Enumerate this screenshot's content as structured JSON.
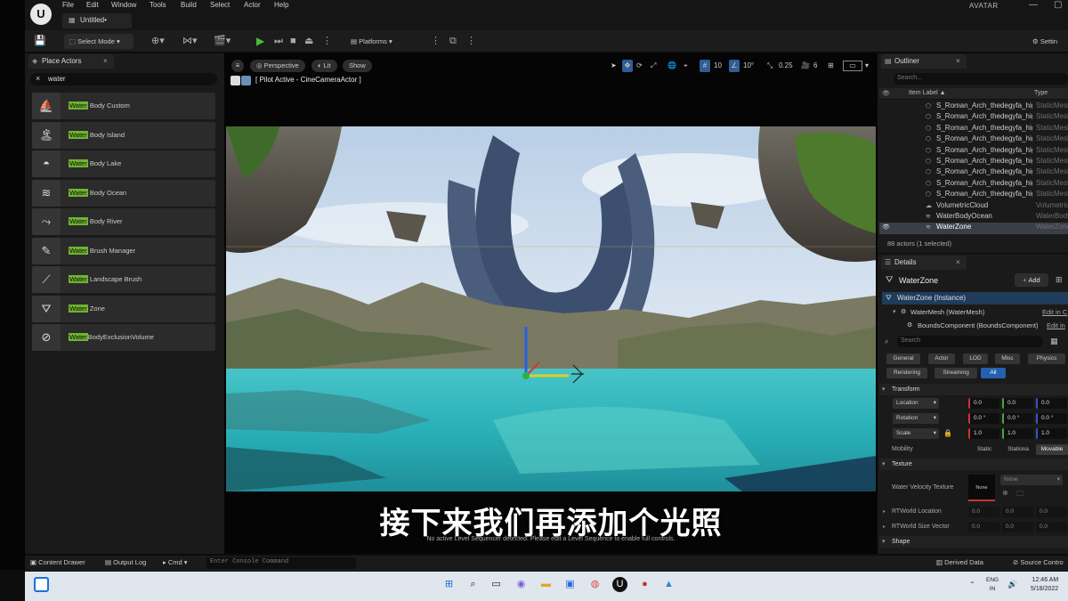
{
  "app": {
    "menu": [
      "File",
      "Edit",
      "Window",
      "Tools",
      "Build",
      "Select",
      "Actor",
      "Help"
    ],
    "document_tab": "Untitled•",
    "project_label": "AVATAR"
  },
  "toolbar": {
    "select_mode": "Select Mode",
    "platforms": "Platforms",
    "settings": "Settin"
  },
  "place_actors": {
    "tab_label": "Place Actors",
    "search_value": "water",
    "highlight": "Water",
    "items": [
      {
        "prefix": "Water",
        "rest": " Body Custom",
        "icon": "water-body-custom-icon"
      },
      {
        "prefix": "Water",
        "rest": " Body Island",
        "icon": "island-icon"
      },
      {
        "prefix": "Water",
        "rest": " Body Lake",
        "icon": "lake-icon"
      },
      {
        "prefix": "Water",
        "rest": " Body Ocean",
        "icon": "ocean-icon"
      },
      {
        "prefix": "Water",
        "rest": " Body River",
        "icon": "river-icon"
      },
      {
        "prefix": "Water",
        "rest": " Brush Manager",
        "icon": "brush-manager-icon"
      },
      {
        "prefix": "Water",
        "rest": " Landscape Brush",
        "icon": "landscape-brush-icon"
      },
      {
        "prefix": "Water",
        "rest": " Zone",
        "icon": "water-zone-icon"
      },
      {
        "prefix": "Water",
        "rest": "BodyExclusionVolume",
        "icon": "exclusion-volume-icon"
      }
    ]
  },
  "viewport": {
    "perspective": "Perspective",
    "lit": "Lit",
    "show": "Show",
    "grid_snap": "10",
    "rotation_snap": "10°",
    "scale_snap": "0.25",
    "camera_speed": "6",
    "pilot_label": "[ Pilot Active - CineCameraActor ]",
    "subtitle": "接下来我们再添加个光照",
    "sequencer_message": "No active Level Sequencer detected. Please edit a Level Sequence to enable full controls."
  },
  "outliner": {
    "tab_label": "Outliner",
    "search_placeholder": "Search...",
    "col_label": "Item Label ▲",
    "col_type": "Type",
    "rows": [
      {
        "name": "S_Roman_Arch_thedegyfa_hig",
        "type": "StaticMesh"
      },
      {
        "name": "S_Roman_Arch_thedegyfa_hig",
        "type": "StaticMesh"
      },
      {
        "name": "S_Roman_Arch_thedegyfa_hig",
        "type": "StaticMesh"
      },
      {
        "name": "S_Roman_Arch_thedegyfa_hig",
        "type": "StaticMesh"
      },
      {
        "name": "S_Roman_Arch_thedegyfa_hig",
        "type": "StaticMesh"
      },
      {
        "name": "S_Roman_Arch_thedegyfa_hig",
        "type": "StaticMesh"
      },
      {
        "name": "S_Roman_Arch_thedegyfa_hig",
        "type": "StaticMesh"
      },
      {
        "name": "S_Roman_Arch_thedegyfa_hig",
        "type": "StaticMesh"
      },
      {
        "name": "S_Roman_Arch_thedegyfa_hig",
        "type": "StaticMesh"
      },
      {
        "name": "VolumetricCloud",
        "type": "Volumetric"
      },
      {
        "name": "WaterBodyOcean",
        "type": "WaterBody"
      },
      {
        "name": "WaterZone",
        "type": "WaterZone"
      }
    ],
    "selected_index": 11,
    "count": "88 actors (1 selected)"
  },
  "details": {
    "tab_label": "Details",
    "title": "WaterZone",
    "add": "Add",
    "instance": "WaterZone (Instance)",
    "components": [
      {
        "label": "WaterMesh (WaterMesh)",
        "link": "Edit in C"
      },
      {
        "label": "BoundsComponent (BoundsComponent)",
        "link": "Edit in"
      }
    ],
    "search_placeholder": "Search",
    "categories": [
      "General",
      "Actor",
      "LOD",
      "Misc",
      "Physics",
      "Rendering",
      "Streaming",
      "All"
    ],
    "active_category": "All",
    "transform_header": "Transform",
    "location_label": "Location",
    "rotation_label": "Rotation",
    "scale_label": "Scale",
    "location": [
      "0.0",
      "0.0",
      "0.0"
    ],
    "rotation": [
      "0.0 °",
      "0.0 °",
      "0.0 °"
    ],
    "scale": [
      "1.0",
      "1.0",
      "1.0"
    ],
    "mobility_label": "Mobility",
    "mobility_options": [
      "Static",
      "Stationa",
      "Movable"
    ],
    "mobility_selected": "Movable",
    "texture_header": "Texture",
    "water_velocity_label": "Water Velocity Texture",
    "texture_thumb": "None",
    "texture_value": "None",
    "rt_location_label": "RTWorld Location",
    "rt_location": [
      "0.0",
      "0.0",
      "0.0"
    ],
    "rt_size_label": "RTWorld Size Vector",
    "rt_size": [
      "0.0",
      "0.0",
      "0.0"
    ],
    "shape_header": "Shape"
  },
  "statusbar": {
    "content_drawer": "Content Drawer",
    "output_log": "Output Log",
    "cmd": "Cmd",
    "console_placeholder": "Enter Console Command",
    "derived_data": "Derived Data",
    "source_control": "Source Contro"
  },
  "taskbar": {
    "lang_top": "ENG",
    "lang_bottom": "IN",
    "time": "12:46 AM",
    "date": "5/18/2022"
  },
  "colors": {
    "search_highlight": "#6fb52f",
    "selection_blue": "#1f3c5a",
    "play_green": "#4cbb3a"
  }
}
